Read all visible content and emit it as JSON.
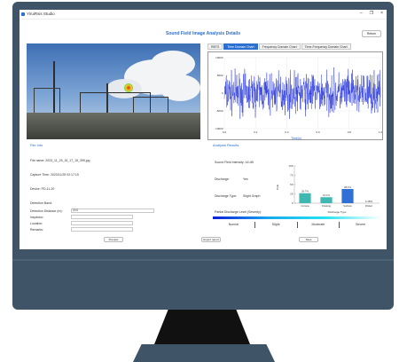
{
  "app": {
    "title": "YiruiRsis Studio",
    "page_title": "Sound Field Image Analysis Details",
    "return_label": "Return",
    "window_controls": [
      "–",
      "❐",
      "×"
    ]
  },
  "tabs": [
    {
      "label": "RBTS",
      "active": false
    },
    {
      "label": "Time Domain Chart",
      "active": true
    },
    {
      "label": "Frequency Domain Chart",
      "active": false
    },
    {
      "label": "Time-Frequency Domain Chart",
      "active": false
    }
  ],
  "signal_chart": {
    "type": "line",
    "xlabel": "Time(s)",
    "yticks": [
      "10000",
      "5000",
      "0",
      "-5000",
      "-10000"
    ],
    "xticks": [
      "0.0",
      "0.2",
      "0.4",
      "0.6",
      "0.8",
      "1.0"
    ],
    "color": "#1f2fd6"
  },
  "file_info": {
    "heading": "File Info",
    "file_name": "File name: 2023_11_25_15_17_15_395.jpg",
    "capture_time": "Capture Time: 2023/11/25 02:17:15",
    "device": "Device: PD-11-20",
    "detection_band": "Detection Band:",
    "fields": [
      {
        "label": "Detection Distance (m):",
        "value": "20.0"
      },
      {
        "label": "Inspector:",
        "value": ""
      },
      {
        "label": "Location:",
        "value": ""
      },
      {
        "label": "Remarks:",
        "value": ""
      }
    ],
    "buttons": {
      "preview": "Preview",
      "export": "Export report",
      "save": "Save"
    }
  },
  "analysis": {
    "heading": "Analysis Results",
    "intensity": "Sound Field Intensity: 44 dB",
    "discharge_label": "Discharge:",
    "discharge_value": "Yes",
    "type_label": "Discharge Type:",
    "type_value": "Slight Graph",
    "severity_label": "Partial Discharge Level (Severity):",
    "severity_levels": [
      "Normal",
      "Slight",
      "Moderate",
      "Severe"
    ]
  },
  "chart_data": {
    "type": "bar",
    "categories": [
      "Corona",
      "Floating",
      "Surface",
      "Flicker"
    ],
    "values": [
      26.7,
      16.1,
      38.1,
      0
    ],
    "data_labels": [
      "26.7%",
      "16.1%",
      "38.1%",
      "0.18%"
    ],
    "ylabel": "Prob",
    "xlabel": "Discharge Type",
    "ylim": [
      0,
      100
    ],
    "yticks": [
      0,
      25,
      50,
      75,
      100
    ],
    "color": "#3fb8b2"
  }
}
